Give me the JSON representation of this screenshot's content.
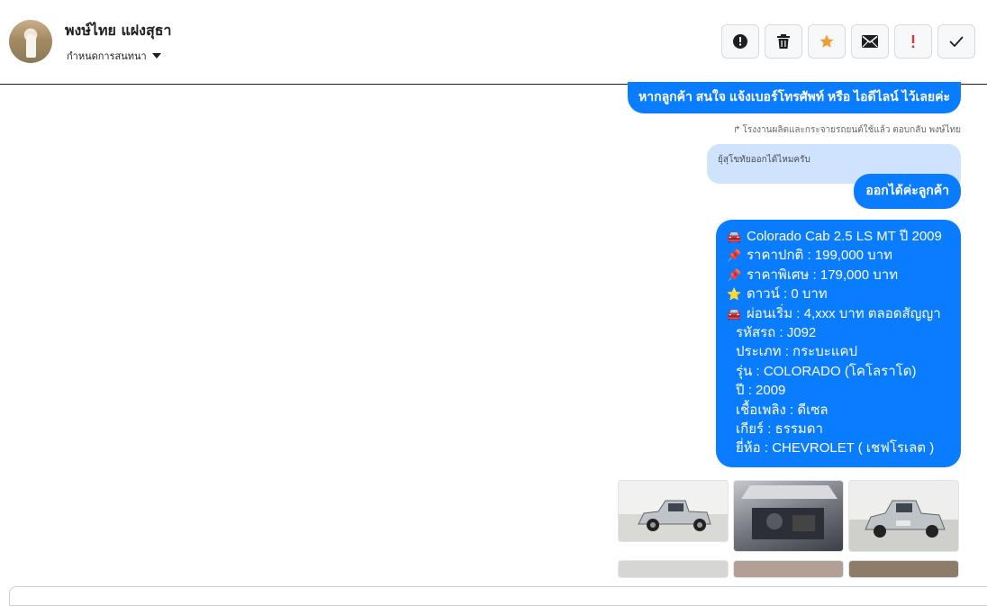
{
  "header": {
    "contact_name": "พงษ์ไทย แฝงสุธา",
    "subtitle": "กำหนดการสนทนา",
    "actions": [
      {
        "name": "alert-circle-icon"
      },
      {
        "name": "trash-icon"
      },
      {
        "name": "star-icon"
      },
      {
        "name": "mail-icon"
      },
      {
        "name": "exclamation-icon"
      },
      {
        "name": "check-icon"
      }
    ]
  },
  "colors": {
    "bubble": "#0a7cff",
    "quoted": "#cfe3ff",
    "star": "#f39c34",
    "exclamation": "#e0362e"
  },
  "messages": {
    "first": "หากลูกค้า สนใจ แจ้งเบอร์โทรศัพท์ หรือ ไอดีไลน์  ไว้เลยค่ะ",
    "reply_meta": "โรงงานผลิตและกระจายรถยนต์ใช้แล้ว ตอบกลับ พงษ์ไทย",
    "quoted": "ยุ้สุโขทัยออกได้ไหมครับ",
    "reply": "ออกได้ค่ะลูกค้า",
    "listing": [
      {
        "icon": "🚘",
        "text": "Colorado Cab 2.5 LS MT ปี 2009"
      },
      {
        "icon": "📌",
        "text": "ราคาปกติ : 199,000 บาท"
      },
      {
        "icon": "📌",
        "text": "ราคาพิเศษ : 179,000 บาท"
      },
      {
        "icon": "⭐",
        "text": "ดาวน์ : 0 บาท"
      },
      {
        "icon": "🚘",
        "text": "ผ่อนเริ่ม : 4,xxx บาท ตลอดสัญญา"
      },
      {
        "icon": "",
        "text": "รหัสรถ : J092"
      },
      {
        "icon": "",
        "text": "ประเภท : กระบะแคป"
      },
      {
        "icon": "",
        "text": "รุ่น : COLORADO (โคโลราโด)"
      },
      {
        "icon": "",
        "text": "ปี : 2009"
      },
      {
        "icon": "",
        "text": "เชื้อเพลิง : ดีเซล"
      },
      {
        "icon": "",
        "text": "เกียร์ : ธรรมดา"
      },
      {
        "icon": "",
        "text": "ยี่ห้อ : CHEVROLET ( เชฟโรเลต )"
      }
    ]
  }
}
